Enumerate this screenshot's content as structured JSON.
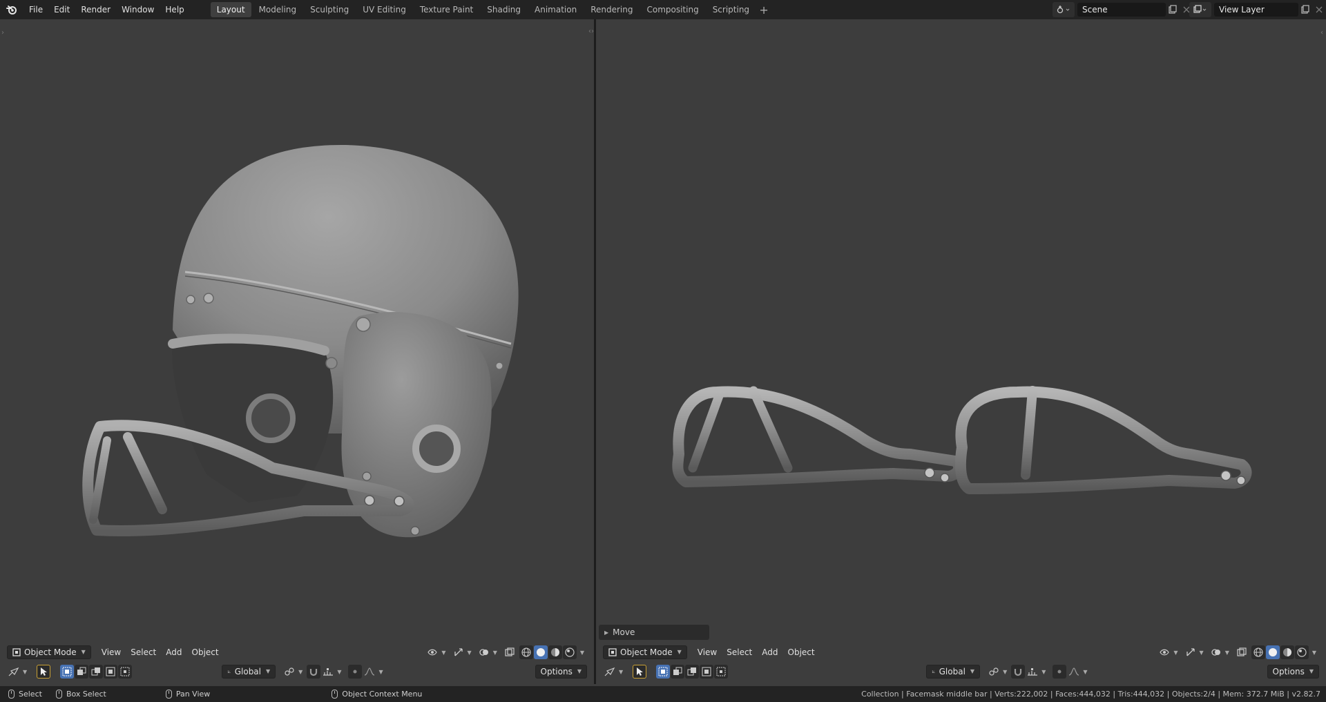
{
  "menu": [
    "File",
    "Edit",
    "Render",
    "Window",
    "Help"
  ],
  "workspaces": [
    "Layout",
    "Modeling",
    "Sculpting",
    "UV Editing",
    "Texture Paint",
    "Shading",
    "Animation",
    "Rendering",
    "Compositing",
    "Scripting"
  ],
  "active_workspace": "Layout",
  "scene": {
    "value": "Scene"
  },
  "view_layer": {
    "value": "View Layer"
  },
  "left_viewport": {
    "mode": "Object Mode",
    "menus": [
      "View",
      "Select",
      "Add",
      "Object"
    ],
    "transform_orientation": "Global",
    "options_label": "Options"
  },
  "right_viewport": {
    "mode": "Object Mode",
    "menus": [
      "View",
      "Select",
      "Add",
      "Object"
    ],
    "transform_orientation": "Global",
    "options_label": "Options",
    "last_operator": "Move"
  },
  "statusbar": {
    "select": "Select",
    "box_select": "Box Select",
    "pan_view": "Pan View",
    "context_menu": "Object Context Menu",
    "info": "Collection | Facemask middle bar | Verts:222,002 | Faces:444,032 | Tris:444,032 | Objects:2/4 | Mem: 372.7 MiB | v2.82.7"
  },
  "colors": {
    "accent": "#4772b3",
    "bg": "#3d3d3d",
    "bar": "#232323"
  }
}
